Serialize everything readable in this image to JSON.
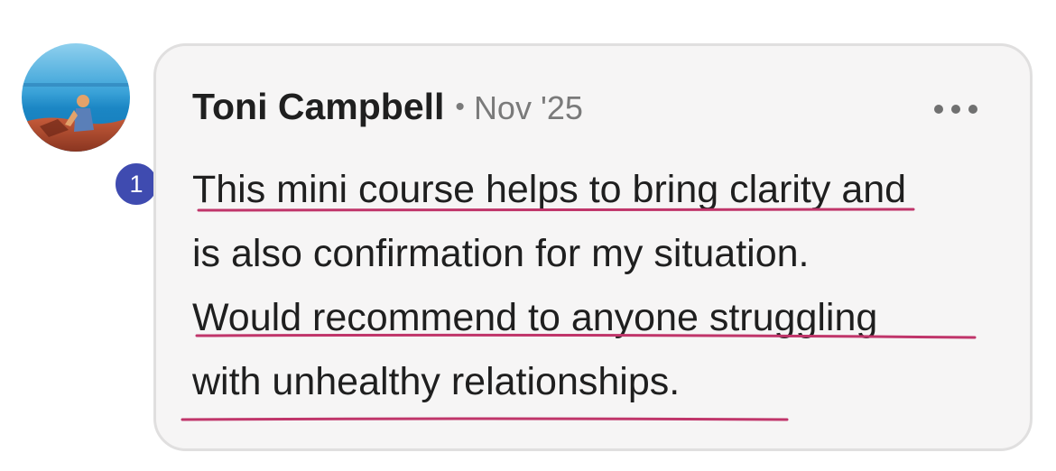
{
  "comment": {
    "avatar_icon": "user-avatar-photo-beach",
    "level": "1",
    "author": "Toni Campbell",
    "separator": "•",
    "date": "Nov '25",
    "more_icon": "more-horizontal-icon",
    "text_lines": [
      "This mini course helps to bring clarity and",
      "is also confirmation for my situation.",
      "Would recommend to anyone struggling",
      "with unhealthy relationships."
    ]
  },
  "colors": {
    "card_bg": "#f6f5f5",
    "card_border": "#e0dfdf",
    "badge_bg": "#3f4bb0",
    "underline": "#c0356a",
    "text": "#1f1f1f",
    "meta": "#7a7a7a"
  }
}
